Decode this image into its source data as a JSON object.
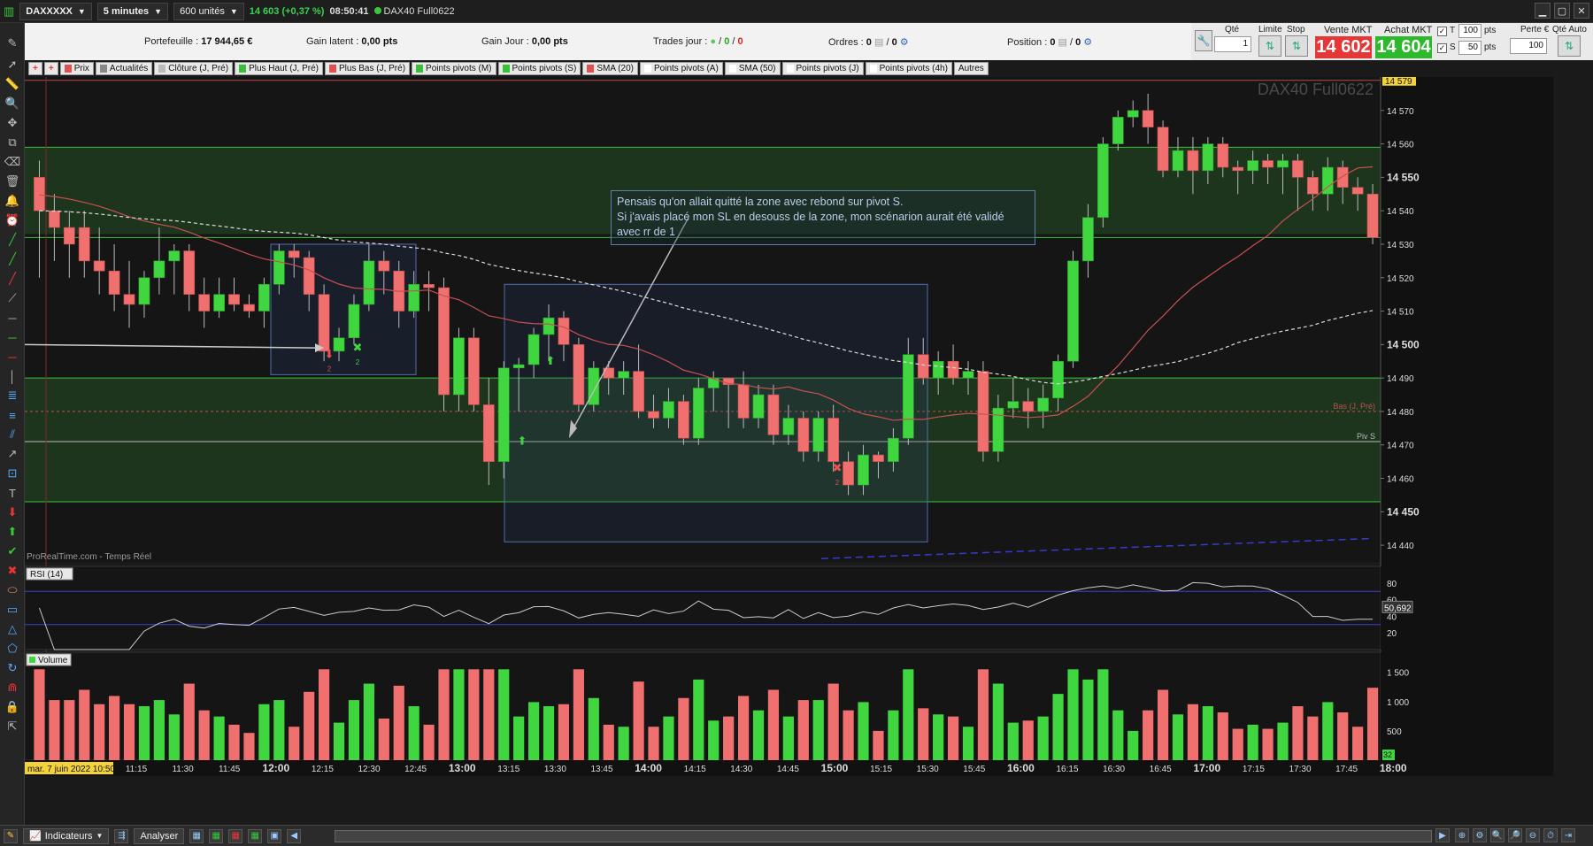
{
  "topbar": {
    "symbol": "DAXXXXX",
    "timeframe": "5 minutes",
    "units": "600 unités",
    "quote": "14 603 (+0,37 %)",
    "time": "08:50:41",
    "instrument": "DAX40 Full0622"
  },
  "account": {
    "portfolio_label": "Portefeuille :",
    "portfolio_value": "17 944,65 €",
    "latent_label": "Gain latent :",
    "latent_value": "0,00 pts",
    "daygain_label": "Gain Jour :",
    "daygain_value": "0,00 pts",
    "trades_label": "Trades jour :",
    "trades_value_a": "0",
    "trades_value_b": "0",
    "orders_label": "Ordres :",
    "orders_a": "0",
    "orders_b": "0",
    "position_label": "Position :",
    "position_value": "0",
    "position_b": "0"
  },
  "order_panel": {
    "qty_label": "Qté",
    "qty_value": "1",
    "limit_label": "Limite",
    "stop_label": "Stop",
    "sell_label": "Vente MKT",
    "sell_price": "14 602",
    "buy_label": "Achat MKT",
    "buy_price": "14 604",
    "t_label": "T",
    "t_value": "100",
    "t_unit": "pts",
    "s_label": "S",
    "s_value": "50",
    "s_unit": "pts",
    "loss_label": "Perte €",
    "loss_value": "100",
    "autoqty_label": "Qté Auto"
  },
  "chips": [
    {
      "label": "Prix",
      "color": "#e05050"
    },
    {
      "label": "Actualités",
      "color": "#888888"
    },
    {
      "label": "Clôture (J, Pré)",
      "color": "#bbbbbb"
    },
    {
      "label": "Plus Haut (J, Pré)",
      "color": "#3bbf3b"
    },
    {
      "label": "Plus Bas (J, Pré)",
      "color": "#e05050"
    },
    {
      "label": "Points pivots (M)",
      "color": "#3bbf3b"
    },
    {
      "label": "Points pivots (S)",
      "color": "#3bbf3b"
    },
    {
      "label": "SMA (20)",
      "color": "#e05050"
    },
    {
      "label": "Points pivots (A)",
      "color": "#ffffff"
    },
    {
      "label": "SMA (50)",
      "color": "#ffffff"
    },
    {
      "label": "Points pivots (J)",
      "color": "#ffffff"
    },
    {
      "label": "Points pivots (4h)",
      "color": "#ffffff"
    },
    {
      "label": "Autres",
      "color": ""
    }
  ],
  "chart": {
    "watermark": "DAX40 Full0622",
    "source": "ProRealTime.com - Temps Réel",
    "price_tag": "14 579",
    "low_label": "Bas (J, Pré)",
    "pivot_label": "Piv S",
    "y_ticks": [
      "14 570",
      "14 560",
      "14 550",
      "14 540",
      "14 530",
      "14 520",
      "14 510",
      "14 500",
      "14 490",
      "14 480",
      "14 470",
      "14 460",
      "14 450",
      "14 440"
    ],
    "y_bold": [
      "14 550",
      "14 500",
      "14 450"
    ],
    "annotation": [
      "Pensais qu'on allait quitté la zone avec rebond sur pivot S.",
      "Si j'avais placé mon SL en desouss de la zone, mon scénarion aurait été validé",
      "avec rr de 1"
    ],
    "marker_count_a": "2",
    "marker_count_b": "2",
    "marker_count_c": "2"
  },
  "rsi": {
    "label": "RSI (14)",
    "value": "50,692",
    "ticks": [
      "80",
      "60",
      "40",
      "20"
    ]
  },
  "volume": {
    "label": "Volume",
    "ticks": [
      "1 500",
      "1 000",
      "500"
    ],
    "value": "32"
  },
  "xaxis": {
    "date": "mar. 7 juin 2022 10:50",
    "labels": [
      "11:15",
      "11:30",
      "11:45",
      "12:00",
      "12:15",
      "12:30",
      "12:45",
      "13:00",
      "13:15",
      "13:30",
      "13:45",
      "14:00",
      "14:15",
      "14:30",
      "14:45",
      "15:00",
      "15:15",
      "15:30",
      "15:45",
      "16:00",
      "16:15",
      "16:30",
      "16:45",
      "17:00",
      "17:15",
      "17:30",
      "17:45",
      "18:00"
    ],
    "bold": [
      "12:00",
      "13:00",
      "14:00",
      "15:00",
      "16:00",
      "17:00",
      "18:00"
    ]
  },
  "bottombar": {
    "indicators": "Indicateurs",
    "analyze": "Analyser"
  },
  "chart_data": {
    "type": "candlestick",
    "interval": "5 minutes",
    "ylim": [
      14435,
      14580
    ],
    "candles": [
      [
        14550,
        14540,
        14555,
        14520
      ],
      [
        14540,
        14535,
        14545,
        14525
      ],
      [
        14535,
        14530,
        14540,
        14520
      ],
      [
        14535,
        14525,
        14540,
        14520
      ],
      [
        14525,
        14522,
        14535,
        14515
      ],
      [
        14522,
        14515,
        14530,
        14510
      ],
      [
        14515,
        14512,
        14525,
        14505
      ],
      [
        14512,
        14520,
        14522,
        14508
      ],
      [
        14520,
        14525,
        14535,
        14515
      ],
      [
        14525,
        14528,
        14530,
        14515
      ],
      [
        14528,
        14515,
        14530,
        14510
      ],
      [
        14515,
        14510,
        14520,
        14505
      ],
      [
        14510,
        14515,
        14520,
        14508
      ],
      [
        14515,
        14512,
        14520,
        14510
      ],
      [
        14512,
        14510,
        14515,
        14508
      ],
      [
        14510,
        14518,
        14520,
        14505
      ],
      [
        14518,
        14528,
        14530,
        14515
      ],
      [
        14528,
        14526,
        14530,
        14520
      ],
      [
        14526,
        14515,
        14528,
        14510
      ],
      [
        14515,
        14498,
        14518,
        14495
      ],
      [
        14498,
        14502,
        14505,
        14495
      ],
      [
        14502,
        14512,
        14515,
        14500
      ],
      [
        14512,
        14525,
        14530,
        14510
      ],
      [
        14525,
        14522,
        14528,
        14515
      ],
      [
        14522,
        14510,
        14525,
        14505
      ],
      [
        14510,
        14518,
        14522,
        14508
      ],
      [
        14518,
        14517,
        14522,
        14510
      ],
      [
        14517,
        14485,
        14520,
        14480
      ],
      [
        14485,
        14502,
        14505,
        14480
      ],
      [
        14502,
        14482,
        14505,
        14480
      ],
      [
        14482,
        14465,
        14490,
        14458
      ],
      [
        14465,
        14493,
        14495,
        14460
      ],
      [
        14493,
        14494,
        14496,
        14480
      ],
      [
        14494,
        14503,
        14505,
        14490
      ],
      [
        14503,
        14508,
        14512,
        14495
      ],
      [
        14508,
        14500,
        14510,
        14495
      ],
      [
        14500,
        14482,
        14502,
        14480
      ],
      [
        14482,
        14493,
        14495,
        14480
      ],
      [
        14493,
        14490,
        14495,
        14485
      ],
      [
        14490,
        14492,
        14495,
        14485
      ],
      [
        14492,
        14480,
        14500,
        14478
      ],
      [
        14480,
        14478,
        14485,
        14475
      ],
      [
        14478,
        14483,
        14487,
        14475
      ],
      [
        14483,
        14472,
        14485,
        14470
      ],
      [
        14472,
        14487,
        14490,
        14470
      ],
      [
        14487,
        14490,
        14492,
        14480
      ],
      [
        14490,
        14488,
        14490,
        14475
      ],
      [
        14488,
        14478,
        14492,
        14475
      ],
      [
        14478,
        14485,
        14488,
        14475
      ],
      [
        14485,
        14473,
        14488,
        14470
      ],
      [
        14473,
        14478,
        14482,
        14470
      ],
      [
        14478,
        14468,
        14480,
        14465
      ],
      [
        14468,
        14478,
        14480,
        14465
      ],
      [
        14478,
        14465,
        14482,
        14462
      ],
      [
        14465,
        14458,
        14468,
        14455
      ],
      [
        14458,
        14467,
        14470,
        14455
      ],
      [
        14467,
        14465,
        14468,
        14460
      ],
      [
        14465,
        14472,
        14475,
        14462
      ],
      [
        14472,
        14497,
        14502,
        14470
      ],
      [
        14497,
        14490,
        14502,
        14488
      ],
      [
        14490,
        14495,
        14498,
        14485
      ],
      [
        14495,
        14490,
        14500,
        14488
      ],
      [
        14490,
        14492,
        14495,
        14485
      ],
      [
        14492,
        14468,
        14495,
        14465
      ],
      [
        14468,
        14481,
        14485,
        14465
      ],
      [
        14481,
        14483,
        14490,
        14478
      ],
      [
        14483,
        14480,
        14487,
        14475
      ],
      [
        14480,
        14484,
        14488,
        14475
      ],
      [
        14484,
        14495,
        14497,
        14480
      ],
      [
        14495,
        14525,
        14528,
        14493
      ],
      [
        14525,
        14538,
        14542,
        14520
      ],
      [
        14538,
        14560,
        14562,
        14535
      ],
      [
        14560,
        14568,
        14570,
        14558
      ],
      [
        14568,
        14570,
        14573,
        14565
      ],
      [
        14570,
        14565,
        14575,
        14560
      ],
      [
        14565,
        14552,
        14567,
        14550
      ],
      [
        14552,
        14558,
        14562,
        14550
      ],
      [
        14558,
        14552,
        14562,
        14545
      ],
      [
        14552,
        14560,
        14562,
        14548
      ],
      [
        14560,
        14553,
        14562,
        14550
      ],
      [
        14553,
        14552,
        14555,
        14545
      ],
      [
        14552,
        14555,
        14558,
        14548
      ],
      [
        14555,
        14553,
        14557,
        14548
      ],
      [
        14553,
        14555,
        14557,
        14545
      ],
      [
        14555,
        14550,
        14557,
        14540
      ],
      [
        14550,
        14545,
        14552,
        14540
      ],
      [
        14545,
        14553,
        14556,
        14540
      ],
      [
        14553,
        14547,
        14555,
        14542
      ],
      [
        14547,
        14545,
        14550,
        14540
      ],
      [
        14545,
        14532,
        14548,
        14530
      ]
    ],
    "sma20_start": 14545,
    "sma50_start": 14540,
    "pivot_lines": [
      14559,
      14532,
      14490,
      14471,
      14453
    ],
    "low_prev_day": 14480,
    "zones": [
      {
        "from": 14533,
        "to": 14559
      },
      {
        "from": 14453,
        "to": 14490
      }
    ],
    "rsi_value": 50.692,
    "rsi_levels": [
      70,
      30
    ],
    "volume_ylim": [
      0,
      1600
    ]
  }
}
